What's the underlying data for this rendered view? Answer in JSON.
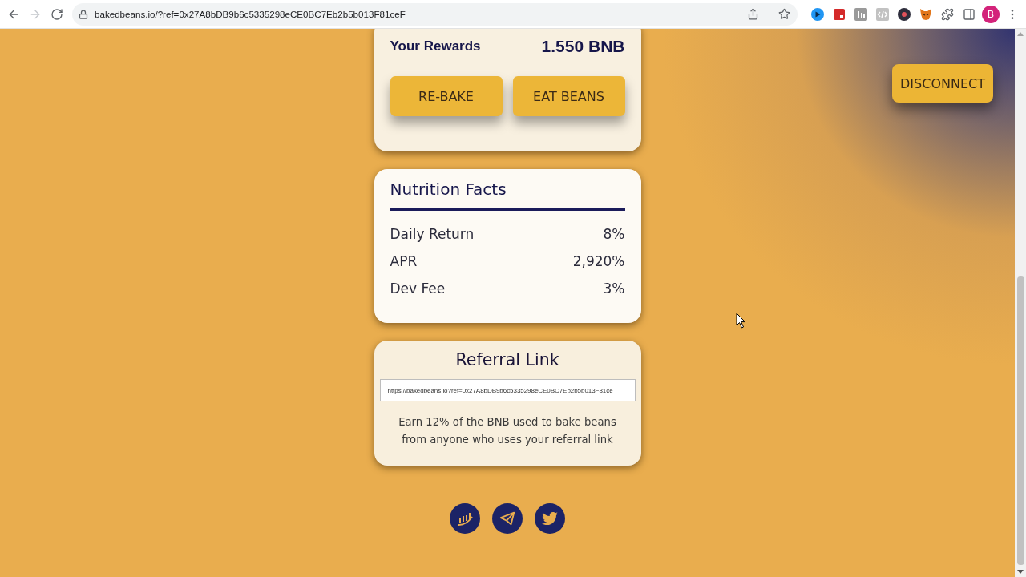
{
  "browser": {
    "nav_buttons": [
      {
        "kind": "back",
        "disabled": false
      },
      {
        "kind": "forward",
        "disabled": true
      },
      {
        "kind": "reload",
        "disabled": false
      }
    ],
    "url": "bakedbeans.io/?ref=0x27A8bDB9b6c5335298eCE0BC7Eb2b5b013F81ceF",
    "profile_initial": "B"
  },
  "disconnect_button": "DISCONNECT",
  "rewards": {
    "label": "Your Rewards",
    "value": "1.550 BNB",
    "buttons": [
      "RE-BAKE",
      "EAT BEANS"
    ]
  },
  "nutrition_facts": {
    "title": "Nutrition Facts",
    "rows": [
      {
        "label": "Daily Return",
        "value": "8%"
      },
      {
        "label": "APR",
        "value": "2,920%"
      },
      {
        "label": "Dev Fee",
        "value": "3%"
      }
    ]
  },
  "referral": {
    "title": "Referral Link",
    "link": "https://bakedbeans.io?ref=0x27A8bDB9b6c5335298eCE0BC7Eb2b5b013F81ce",
    "description": "Earn 12% of the BNB used to bake beans from anyone who uses your referral link"
  },
  "social_links": [
    {
      "kind": "chart"
    },
    {
      "kind": "telegram"
    },
    {
      "kind": "twitter"
    }
  ]
}
